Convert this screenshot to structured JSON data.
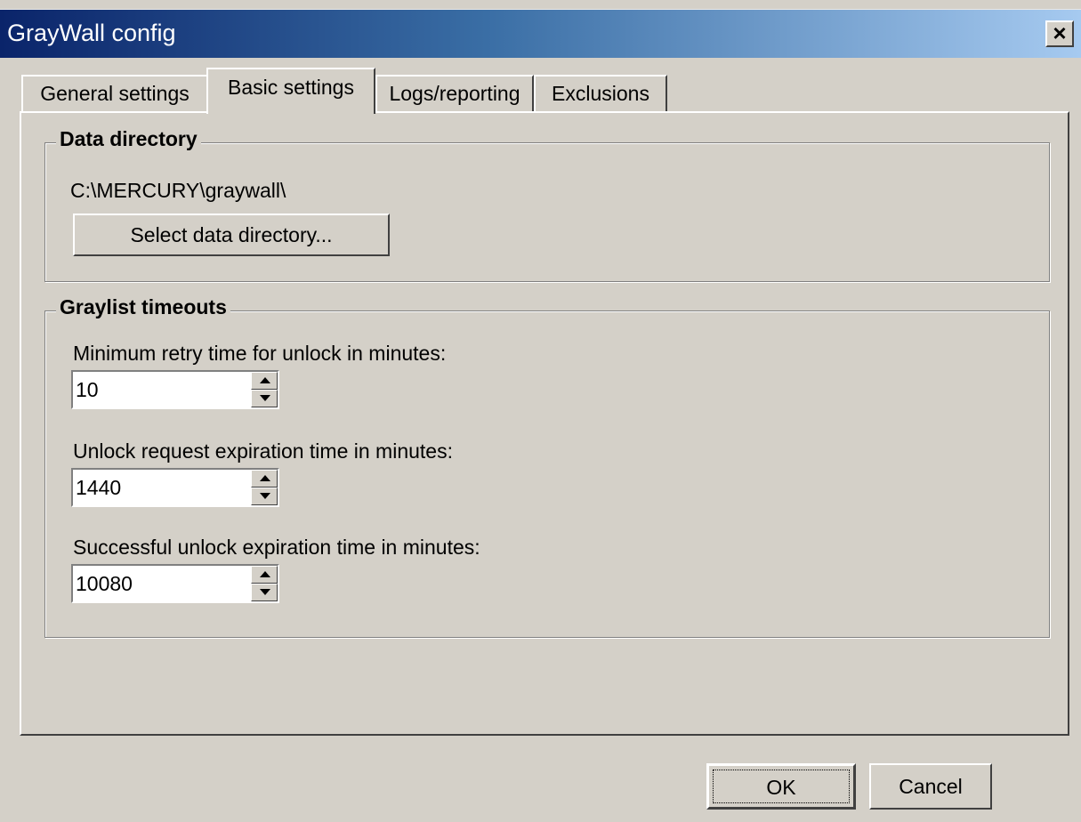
{
  "window": {
    "title": "GrayWall config",
    "close_symbol": "×"
  },
  "tabs": [
    {
      "label": "General settings",
      "active": false
    },
    {
      "label": "Basic settings",
      "active": true
    },
    {
      "label": "Logs/reporting",
      "active": false
    },
    {
      "label": "Exclusions",
      "active": false
    }
  ],
  "data_directory": {
    "group_title": "Data directory",
    "path": "C:\\MERCURY\\graywall\\",
    "select_button": "Select data directory..."
  },
  "graylist_timeouts": {
    "group_title": "Graylist timeouts",
    "fields": [
      {
        "label": "Minimum retry time for unlock in minutes:",
        "value": "10"
      },
      {
        "label": "Unlock request expiration time in minutes:",
        "value": "1440"
      },
      {
        "label": "Successful unlock expiration time in minutes:",
        "value": "10080"
      }
    ]
  },
  "footer": {
    "ok_label": "OK",
    "cancel_label": "Cancel"
  },
  "colors": {
    "face": "#d4d0c8",
    "title_gradient_start": "#0a246a",
    "title_gradient_end": "#a6caf0"
  }
}
